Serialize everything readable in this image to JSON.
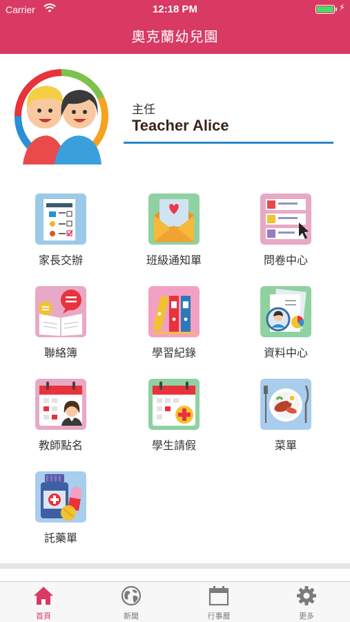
{
  "status": {
    "carrier": "Carrier",
    "time": "12:18 PM",
    "battery_level": 1.0
  },
  "nav": {
    "title": "奧克蘭幼兒園"
  },
  "profile": {
    "role": "主任",
    "name": "Teacher Alice"
  },
  "menu": [
    {
      "label": "家長交辦",
      "icon": "checklist-form-icon"
    },
    {
      "label": "班級通知單",
      "icon": "envelope-heart-icon"
    },
    {
      "label": "問卷中心",
      "icon": "survey-questions-icon"
    },
    {
      "label": "聯絡簿",
      "icon": "chat-book-icon"
    },
    {
      "label": "學習紀錄",
      "icon": "binders-icon"
    },
    {
      "label": "資料中心",
      "icon": "documents-person-icon"
    },
    {
      "label": "教師點名",
      "icon": "calendar-teacher-icon"
    },
    {
      "label": "學生請假",
      "icon": "calendar-medical-icon"
    },
    {
      "label": "菜單",
      "icon": "meal-plate-icon"
    },
    {
      "label": "託藥單",
      "icon": "medicine-bottle-icon"
    }
  ],
  "tabs": [
    {
      "label": "首頁",
      "icon": "home-icon",
      "active": true
    },
    {
      "label": "新聞",
      "icon": "globe-icon",
      "active": false
    },
    {
      "label": "行事曆",
      "icon": "calendar-icon",
      "active": false
    },
    {
      "label": "更多",
      "icon": "gear-icon",
      "active": false
    }
  ],
  "colors": {
    "brand": "#d83a64",
    "accent": "#2a86c6",
    "inactive_tab": "#7b7b7b"
  }
}
